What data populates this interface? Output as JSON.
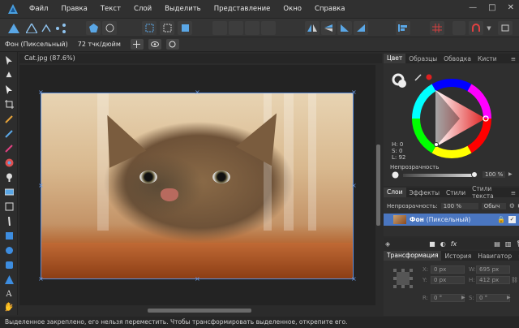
{
  "menu": {
    "items": [
      "Файл",
      "Правка",
      "Текст",
      "Слой",
      "Выделить",
      "Представление",
      "Окно",
      "Справка"
    ],
    "window_buttons": [
      "—",
      "□",
      "✕"
    ]
  },
  "context": {
    "layer_type": "Фон (Пиксельный)",
    "dpi": "72 тчк/дюйм"
  },
  "document": {
    "tab_title": "Cat.jpg (87.6%)"
  },
  "color_panel": {
    "tabs": [
      "Цвет",
      "Образцы",
      "Обводка",
      "Кисти"
    ],
    "hsl": {
      "h": "H: 0",
      "s": "S: 0",
      "l": "L: 92"
    },
    "opacity_label": "Непрозрачность",
    "opacity_value": "100 %",
    "opacity_fraction": 1.0
  },
  "layers_panel": {
    "tabs": [
      "Слои",
      "Эффекты",
      "Стили",
      "Стили текста"
    ],
    "opacity_label": "Непрозрачность:",
    "opacity_value": "100 %",
    "blend_mode": "Обыч",
    "layer_name": "Фон",
    "layer_type": "(Пиксельный)"
  },
  "transform_panel": {
    "tabs": [
      "Трансформация",
      "История",
      "Навигатор"
    ],
    "x_label": "X:",
    "x_value": "0 px",
    "y_label": "Y:",
    "y_value": "0 px",
    "w_label": "W:",
    "w_value": "695 px",
    "h_label": "H:",
    "h_value": "412 px",
    "r_label": "R:",
    "r_value": "0 °",
    "s_label": "S:",
    "s_value": "0 °"
  },
  "status": {
    "text": "Выделенное закреплено, его нельзя переместить. Чтобы трансформировать выделенное, открепите его."
  },
  "colors": {
    "accent": "#5b8ddb",
    "layer_selected": "#4a76c0"
  }
}
